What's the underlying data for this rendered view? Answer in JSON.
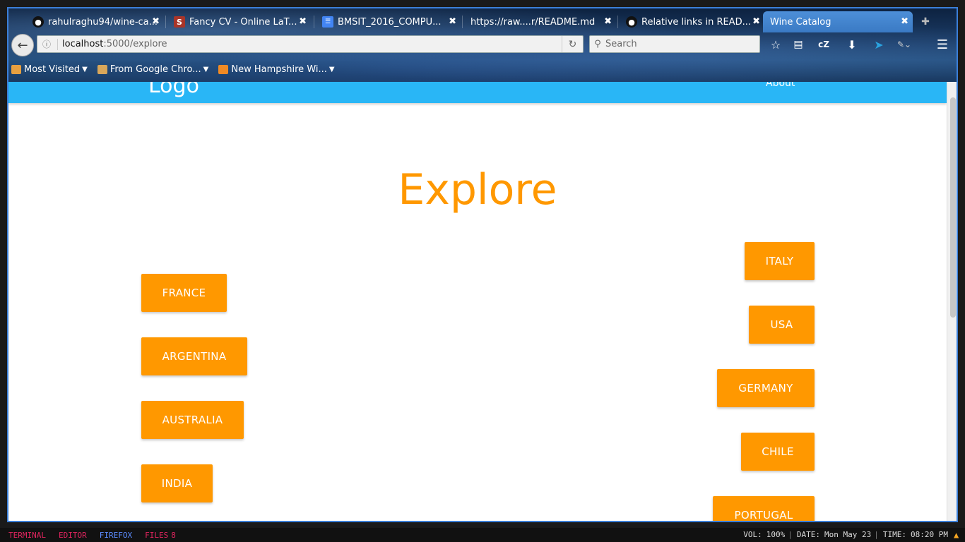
{
  "tabs": [
    {
      "title": "rahulraghu94/wine-ca...",
      "icon": "github-icon",
      "fav_color": "#ffffff"
    },
    {
      "title": "Fancy CV - Online LaT...",
      "icon": "sharelatex-icon",
      "fav_color": "#a93529"
    },
    {
      "title": "BMSIT_2016_COMPU...",
      "icon": "google-docs-icon",
      "fav_color": "#4285f4"
    },
    {
      "title": "https://raw....r/README.md",
      "icon": "none",
      "fav_color": ""
    },
    {
      "title": "Relative links in READ...",
      "icon": "github-icon",
      "fav_color": "#ffffff"
    },
    {
      "title": "Wine Catalog",
      "icon": "none",
      "fav_color": "",
      "active": true
    }
  ],
  "url": {
    "host": "localhost",
    "path": ":5000/explore"
  },
  "search_placeholder": "Search",
  "toolbar_icons": [
    "bookmark-star-icon",
    "reader-icon",
    "cz-icon",
    "download-icon",
    "telegram-icon",
    "extension-icon",
    "menu-icon"
  ],
  "cz_label": "cZ",
  "bookmarks": [
    {
      "label": "Most Visited",
      "icon": "most-visited-icon",
      "color": "#e8a040"
    },
    {
      "label": "From Google Chro...",
      "icon": "folder-icon",
      "color": "#d9a75a"
    },
    {
      "label": "New Hampshire Wi...",
      "icon": "rss-icon",
      "color": "#f08a24"
    }
  ],
  "site": {
    "logo": "Logo",
    "about": "About",
    "title": "Explore",
    "accent": "#ff9800",
    "nav_color": "#29b6f6"
  },
  "countries_left": [
    "FRANCE",
    "ARGENTINA",
    "AUSTRALIA",
    "INDIA"
  ],
  "countries_right": [
    "ITALY",
    "USA",
    "GERMANY",
    "CHILE",
    "PORTUGAL"
  ],
  "status": {
    "workspaces": [
      {
        "label": "TERMINAL",
        "color": "#e0245e"
      },
      {
        "label": "EDITOR",
        "color": "#e0245e"
      },
      {
        "label": "FIREFOX",
        "color": "#5b8cff"
      },
      {
        "label": "FILES",
        "color": "#e0245e"
      },
      {
        "label": "8",
        "color": "#e0245e"
      }
    ],
    "vol_label": "VOL:",
    "vol_value": "100%",
    "date_label": "DATE:",
    "date_value": "Mon May 23",
    "time_label": "TIME:",
    "time_value": "08:20 PM"
  }
}
